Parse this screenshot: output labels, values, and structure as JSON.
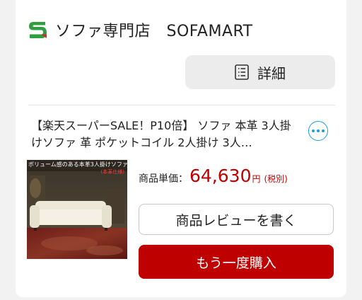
{
  "store": {
    "logo_icon": "sofamart-s-logo-icon",
    "name": "ソファ専門店　SOFAMART"
  },
  "detail_button": {
    "icon": "document-list-icon",
    "label": "詳細"
  },
  "product": {
    "title": "【楽天スーパーSALE！P10倍】 ソファ 本革 3人掛けソファ 革 ポケットコイル 2人掛け 3人…",
    "more_icon": "more-options-icon",
    "image_caption": "ボリューム感のある本革3人掛けソファ",
    "image_badge": "(本革仕様)",
    "price_label": "商品単価：",
    "price_value": "64,630",
    "price_unit": "円",
    "price_tax": "(税別)"
  },
  "actions": {
    "review_label": "商品レビューを書く",
    "rebuy_label": "もう一度購入"
  },
  "colors": {
    "accent_red": "#bf0000",
    "info_blue": "#1a9edb",
    "logo_green": "#2e9e3e"
  }
}
